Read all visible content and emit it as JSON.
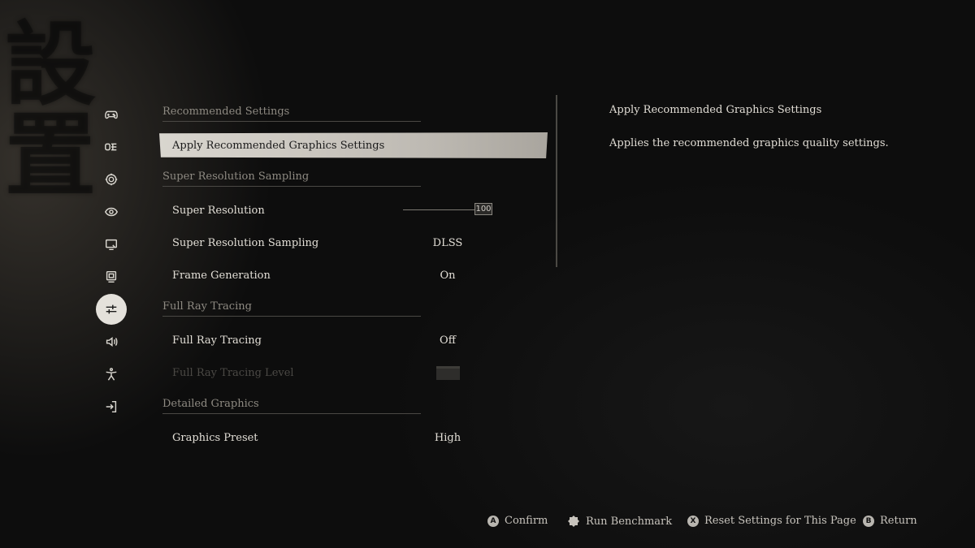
{
  "watermark": "設置",
  "sidebar": {
    "items": [
      {
        "icon": "gamepad-icon",
        "active": false
      },
      {
        "icon": "keyboard-icon",
        "active": false
      },
      {
        "icon": "gear-icon",
        "active": false
      },
      {
        "icon": "eye-icon",
        "active": false
      },
      {
        "icon": "display-icon",
        "active": false
      },
      {
        "icon": "monitor-icon",
        "active": false
      },
      {
        "icon": "sliders-icon",
        "active": true
      },
      {
        "icon": "sound-icon",
        "active": false
      },
      {
        "icon": "accessibility-icon",
        "active": false
      },
      {
        "icon": "exit-icon",
        "active": false
      }
    ]
  },
  "settings": {
    "sections": [
      {
        "header": "Recommended Settings"
      },
      {
        "header": "Super Resolution Sampling"
      },
      {
        "header": "Full Ray Tracing"
      },
      {
        "header": "Detailed Graphics"
      }
    ],
    "rows": {
      "apply_recommended": {
        "label": "Apply Recommended Graphics Settings"
      },
      "super_resolution": {
        "label": "Super Resolution",
        "value": "100",
        "slider_fraction": 1.0
      },
      "super_resolution_sampling": {
        "label": "Super Resolution Sampling",
        "value": "DLSS"
      },
      "frame_generation": {
        "label": "Frame Generation",
        "value": "On"
      },
      "full_ray_tracing": {
        "label": "Full Ray Tracing",
        "value": "Off"
      },
      "full_ray_tracing_level": {
        "label": "Full Ray Tracing Level"
      },
      "graphics_preset": {
        "label": "Graphics Preset",
        "value": "High"
      }
    }
  },
  "description": {
    "title": "Apply Recommended Graphics Settings",
    "body": "Applies the recommended graphics quality settings."
  },
  "hints": {
    "confirm": {
      "button": "A",
      "label": "Confirm"
    },
    "benchmark": {
      "button": "badge",
      "label": "Run Benchmark"
    },
    "reset": {
      "button": "X",
      "label": "Reset Settings for This Page"
    },
    "return": {
      "button": "B",
      "label": "Return"
    }
  },
  "colors": {
    "background": "#0d0d0d",
    "text": "#e2ded6",
    "muted": "#8e8a82",
    "selected_bar": "#d9d6cf"
  }
}
